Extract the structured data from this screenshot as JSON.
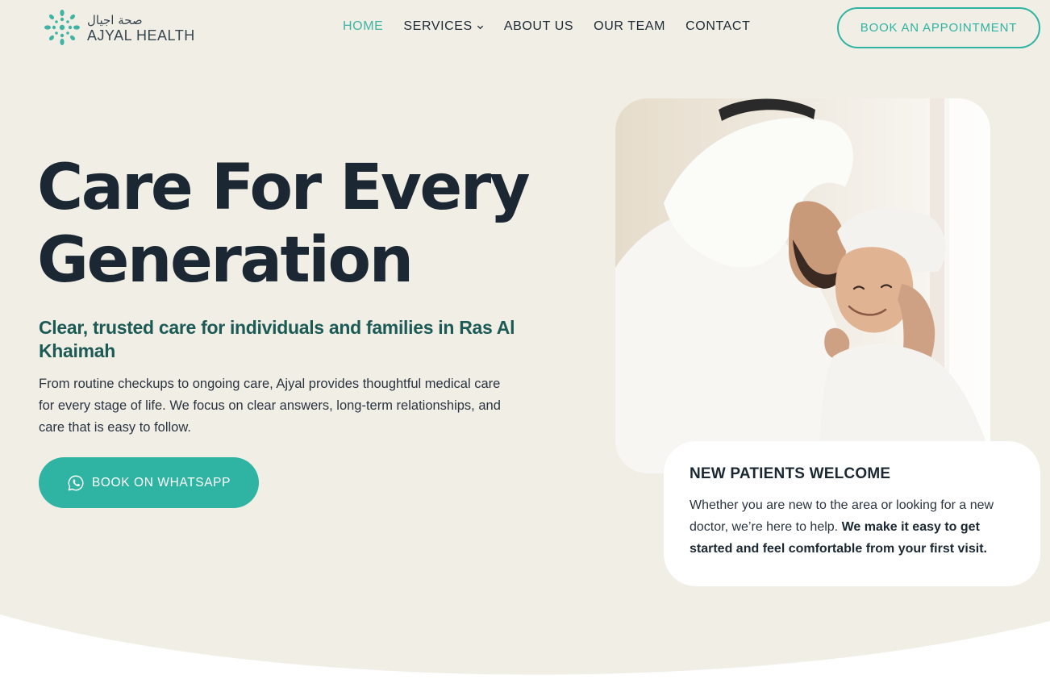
{
  "brand": {
    "arabic_name": "صحة اجيال",
    "name": "AJYAL HEALTH",
    "accent_color": "#2fb3a2",
    "dark_color": "#1b2833"
  },
  "nav": {
    "items": [
      {
        "label": "HOME",
        "active": true
      },
      {
        "label": "SERVICES",
        "has_dropdown": true
      },
      {
        "label": "ABOUT US"
      },
      {
        "label": "OUR TEAM"
      },
      {
        "label": "CONTACT"
      }
    ],
    "cta_label": "BOOK AN APPOINTMENT"
  },
  "hero": {
    "title_line1": "Care For Every",
    "title_line2": "Generation",
    "subtitle": "Clear, trusted care for individuals and families in Ras Al Khaimah",
    "body": "From routine checkups to ongoing care, Ajyal provides thoughtful medical care for every stage of life. We focus on clear answers, long-term relationships, and care that is easy to follow.",
    "whatsapp_label": "BOOK ON WHATSAPP",
    "whatsapp_icon": "whatsapp-icon"
  },
  "card": {
    "title": "NEW PATIENTS WELCOME",
    "body_plain": "Whether you are new to the area or looking for a new doctor, we’re here to help. ",
    "body_bold": "We make it easy to get started and feel comfortable from your first visit."
  }
}
